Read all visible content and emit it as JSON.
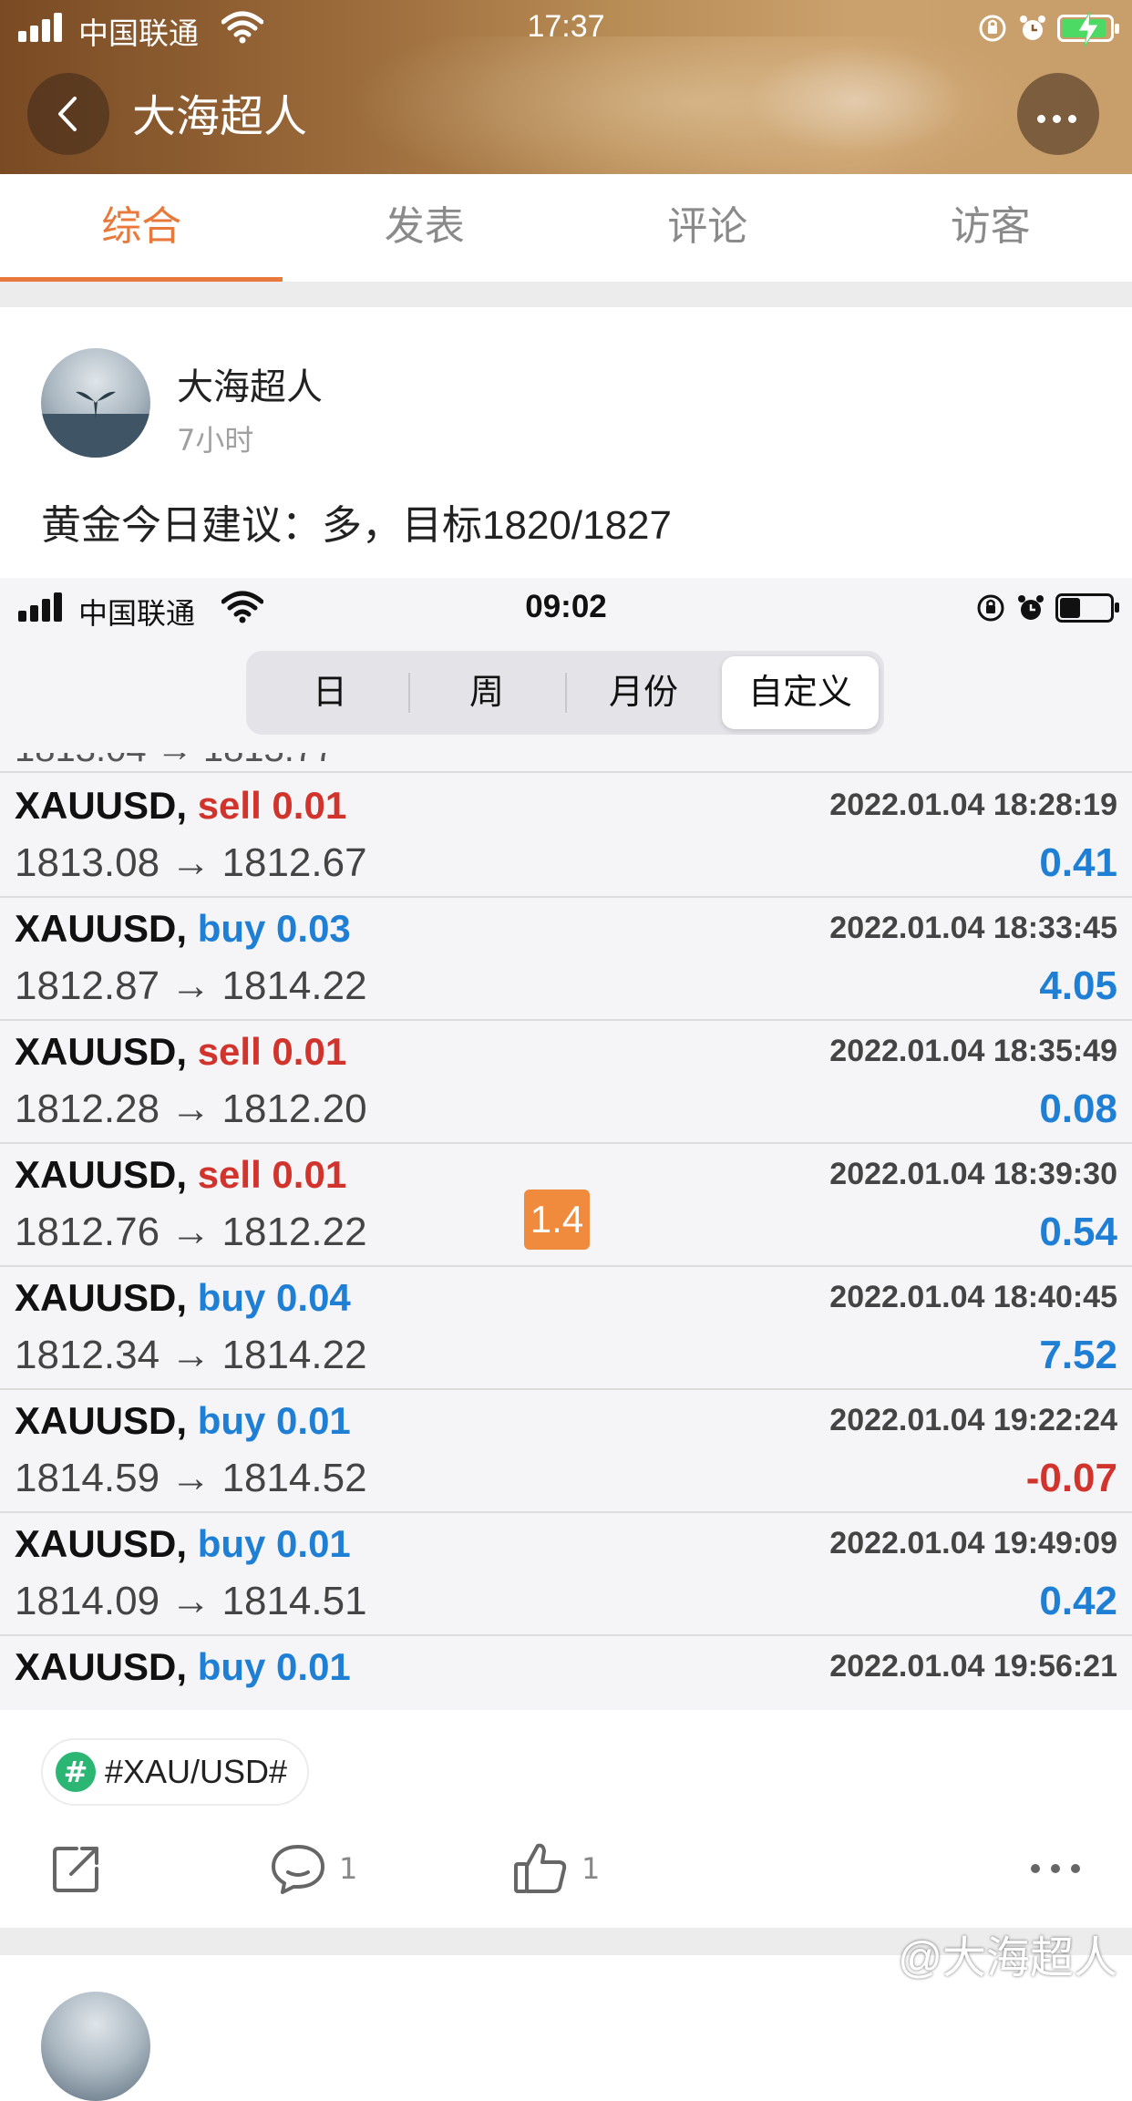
{
  "status_bar": {
    "carrier": "中国联通",
    "time": "17:37"
  },
  "header": {
    "title": "大海超人"
  },
  "tabs": [
    {
      "label": "综合",
      "active": true
    },
    {
      "label": "发表",
      "active": false
    },
    {
      "label": "评论",
      "active": false
    },
    {
      "label": "访客",
      "active": false
    }
  ],
  "post": {
    "author": "大海超人",
    "time": "7小时",
    "text": "黄金今日建议：多，目标1820/1827",
    "topic": "#XAU/USD#",
    "comment_count": "1",
    "like_count": "1"
  },
  "embedded_screenshot": {
    "status_bar": {
      "carrier": "中国联通",
      "time": "09:02"
    },
    "segments": [
      {
        "label": "日",
        "active": false
      },
      {
        "label": "周",
        "active": false
      },
      {
        "label": "月份",
        "active": false
      },
      {
        "label": "自定义",
        "active": true
      }
    ],
    "badge": "1.4",
    "trades": [
      {
        "symbol": "XAUUSD,",
        "side": "sell 0.01",
        "type": "sell",
        "prices": "1813.08 → 1812.67",
        "time": "2022.01.04 18:28:19",
        "profit": "0.41"
      },
      {
        "symbol": "XAUUSD,",
        "side": "buy 0.03",
        "type": "buy",
        "prices": "1812.87 → 1814.22",
        "time": "2022.01.04 18:33:45",
        "profit": "4.05"
      },
      {
        "symbol": "XAUUSD,",
        "side": "sell 0.01",
        "type": "sell",
        "prices": "1812.28 → 1812.20",
        "time": "2022.01.04 18:35:49",
        "profit": "0.08"
      },
      {
        "symbol": "XAUUSD,",
        "side": "sell 0.01",
        "type": "sell",
        "prices": "1812.76 → 1812.22",
        "time": "2022.01.04 18:39:30",
        "profit": "0.54"
      },
      {
        "symbol": "XAUUSD,",
        "side": "buy 0.04",
        "type": "buy",
        "prices": "1812.34 → 1814.22",
        "time": "2022.01.04 18:40:45",
        "profit": "7.52"
      },
      {
        "symbol": "XAUUSD,",
        "side": "buy 0.01",
        "type": "buy",
        "prices": "1814.59 → 1814.52",
        "time": "2022.01.04 19:22:24",
        "profit": "-0.07"
      },
      {
        "symbol": "XAUUSD,",
        "side": "buy 0.01",
        "type": "buy",
        "prices": "1814.09 → 1814.51",
        "time": "2022.01.04 19:49:09",
        "profit": "0.42"
      },
      {
        "symbol": "XAUUSD,",
        "side": "buy 0.01",
        "type": "buy",
        "prices": "",
        "time": "2022.01.04 19:56:21",
        "profit": ""
      }
    ]
  },
  "watermark": "@大海超人",
  "icons": {
    "back": "chevron-left-icon",
    "more": "more-dots-icon",
    "share": "share-icon",
    "comment": "comment-icon",
    "like": "thumbs-up-icon"
  },
  "colors": {
    "accent": "#e8793a",
    "sell": "#d0342c",
    "buy": "#1f7fd4",
    "topic_green": "#2bb673"
  }
}
